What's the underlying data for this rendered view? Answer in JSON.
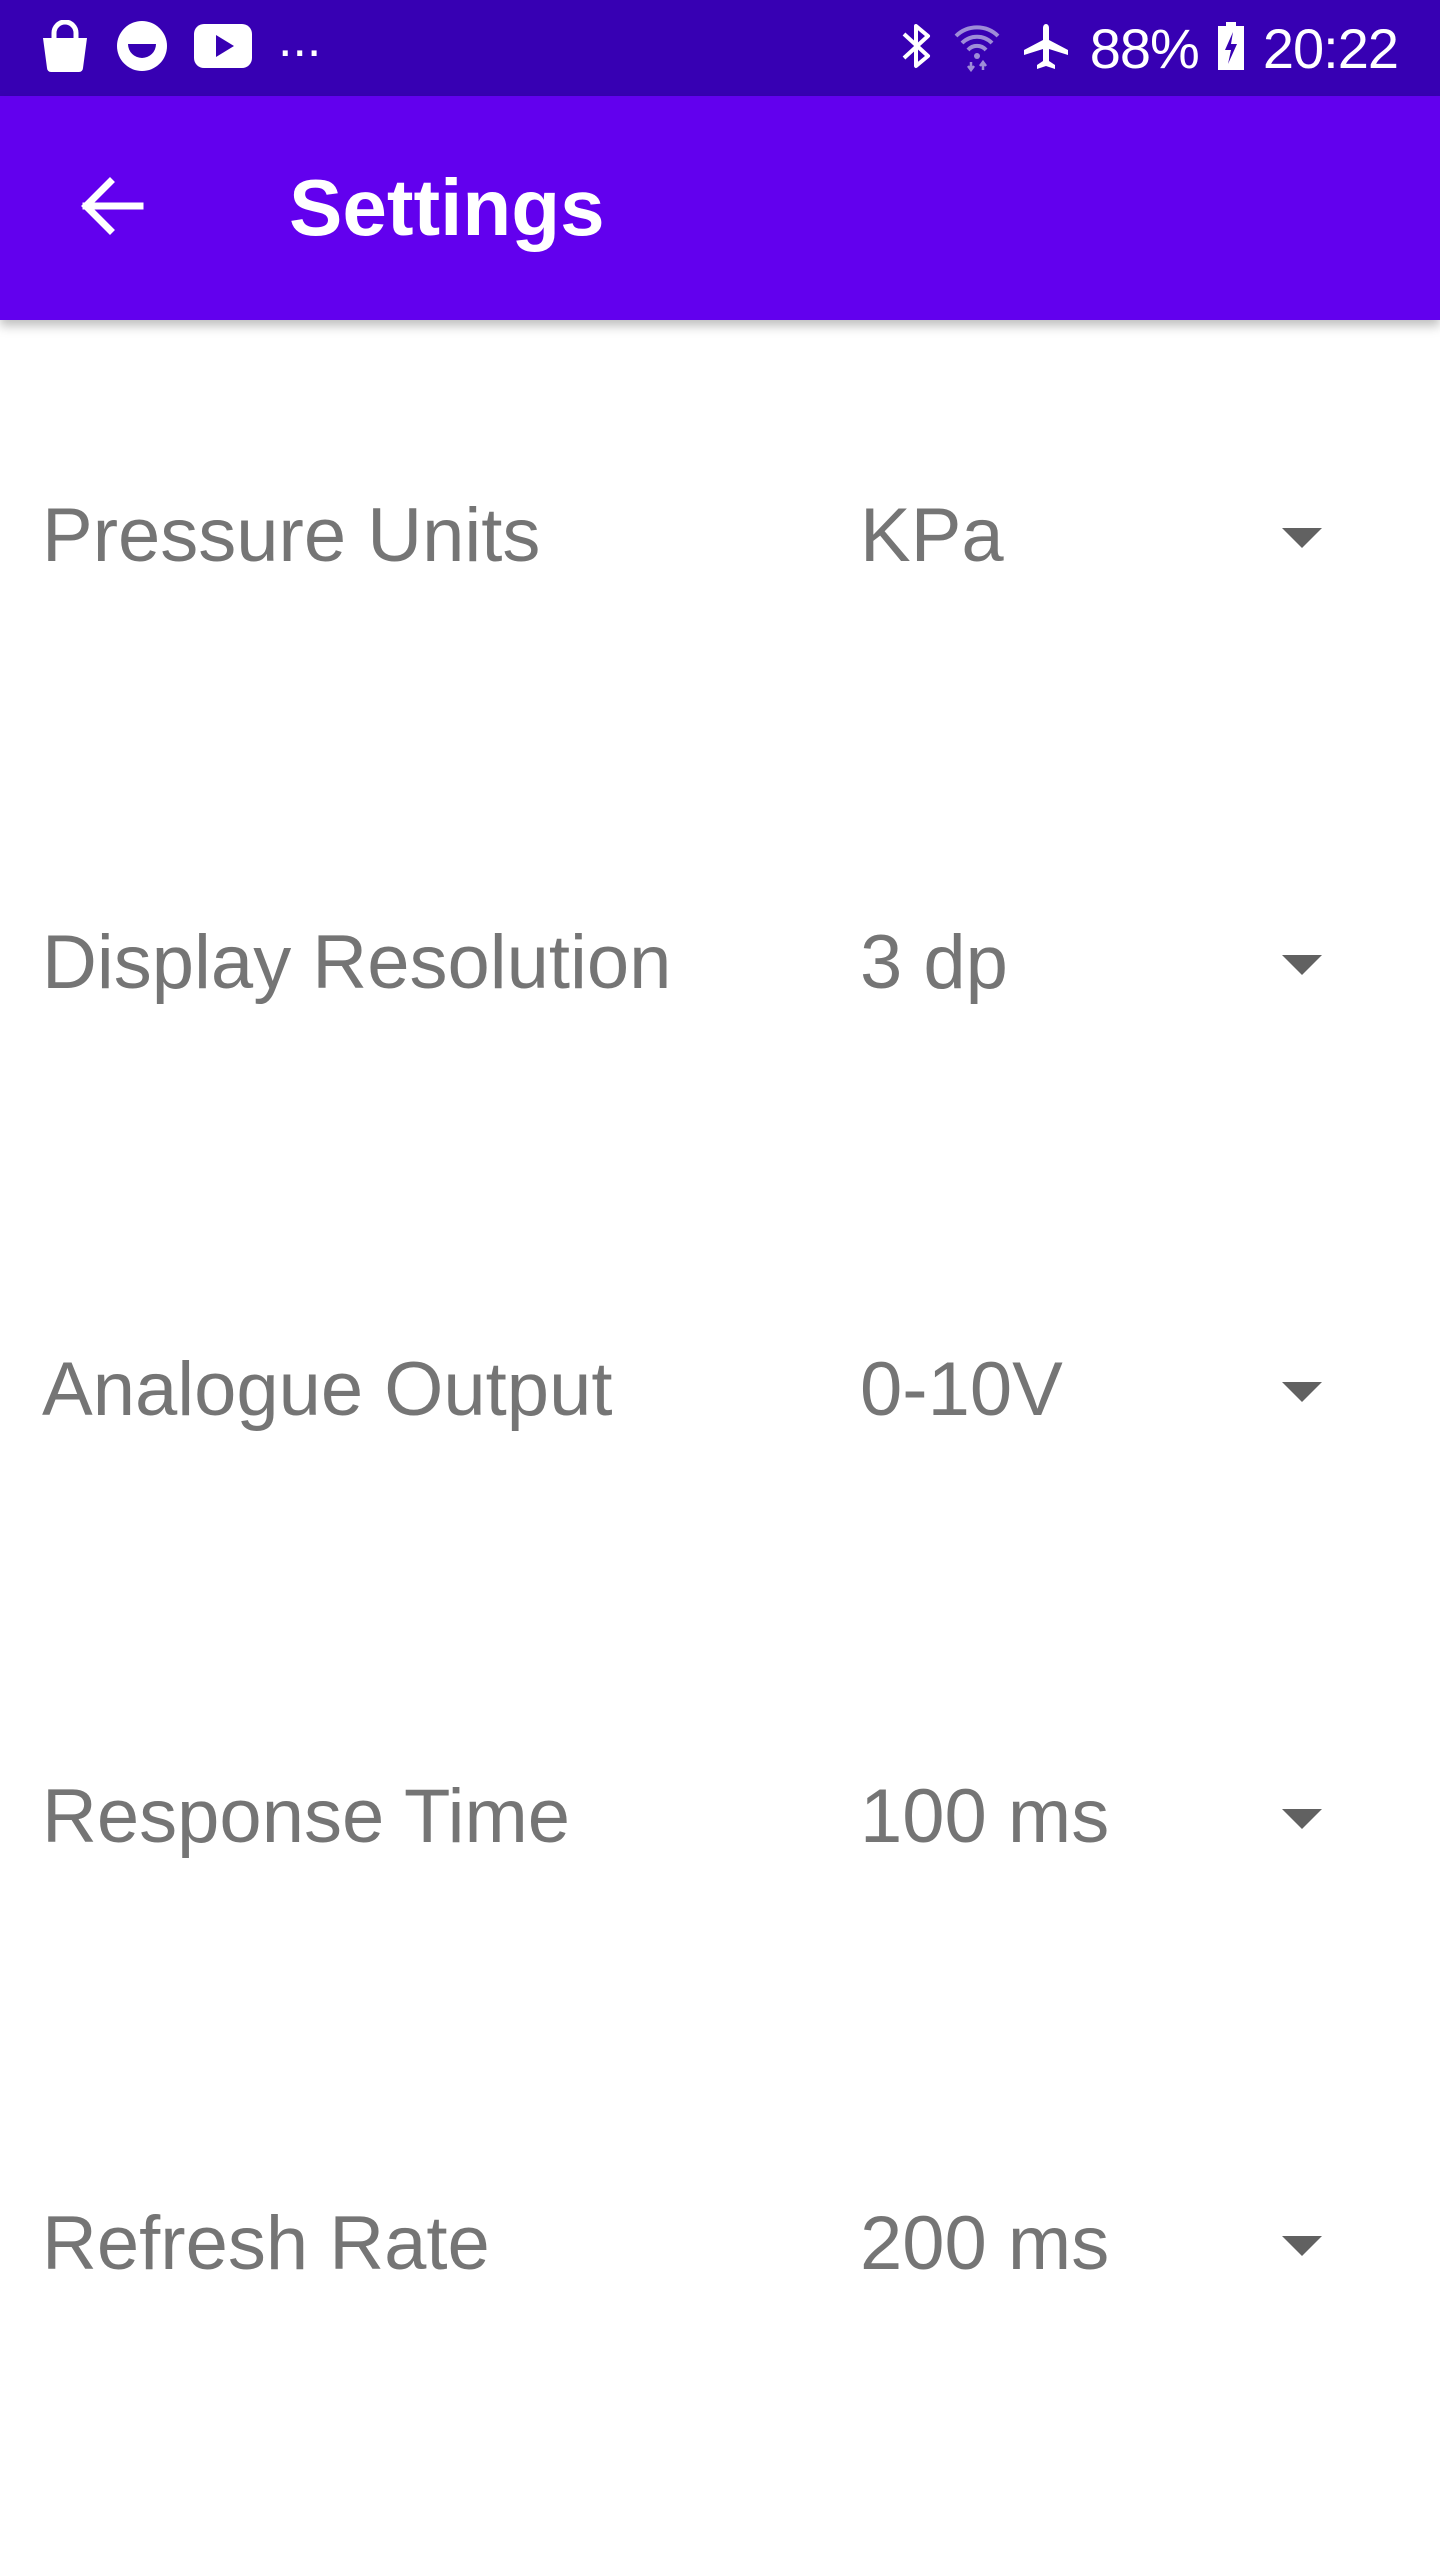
{
  "status_bar": {
    "left_icons": [
      "shopping-bag-icon",
      "smiley-app-icon",
      "youtube-icon"
    ],
    "overflow": "...",
    "right_icons": [
      "bluetooth-icon",
      "wifi-icon",
      "airplane-icon"
    ],
    "battery_percent": "88%",
    "time": "20:22"
  },
  "app_bar": {
    "back_icon": "arrow-back-icon",
    "title": "Settings",
    "background": "#6200EE",
    "status_background": "#3700B3"
  },
  "settings": [
    {
      "label": "Pressure Units",
      "value": "KPa"
    },
    {
      "label": "Display Resolution",
      "value": "3 dp"
    },
    {
      "label": "Analogue Output",
      "value": "0-10V"
    },
    {
      "label": "Response Time",
      "value": "100 ms"
    },
    {
      "label": "Refresh Rate",
      "value": "200 ms"
    }
  ]
}
